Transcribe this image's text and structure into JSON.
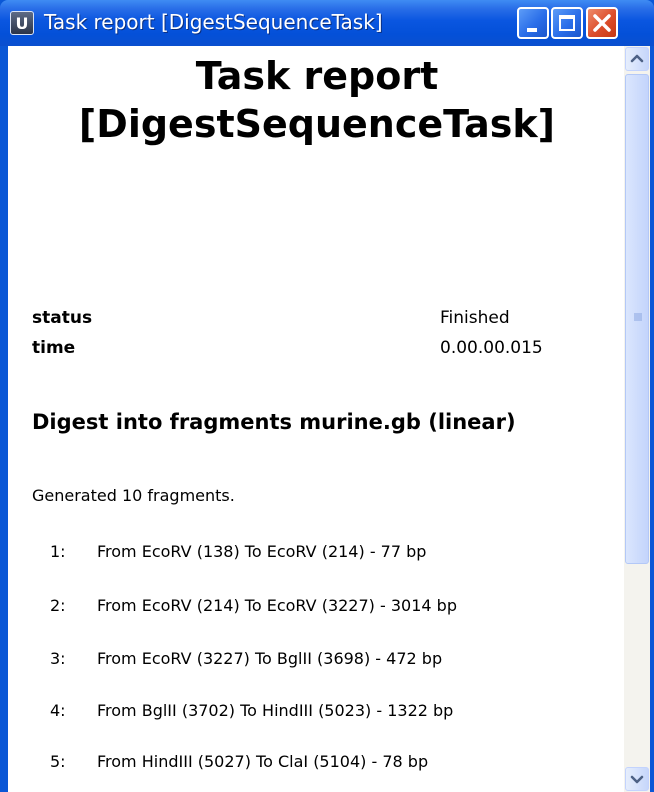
{
  "window": {
    "title": "Task report [DigestSequenceTask]",
    "app_icon_letter": "U",
    "controls": {
      "minimize": "minimize-icon",
      "maximize": "maximize-icon",
      "close": "close-icon"
    }
  },
  "report": {
    "title_line1": "Task report",
    "title_line2": "[DigestSequenceTask]",
    "status_key": "status",
    "status_value": "Finished",
    "time_key": "time",
    "time_value": "0.00.00.015",
    "section_heading": "Digest into fragments murine.gb (linear)",
    "summary": "Generated 10 fragments.",
    "fragments": [
      {
        "num": "1:",
        "text": "From EcoRV (138) To EcoRV (214) - 77 bp"
      },
      {
        "num": "2:",
        "text": "From EcoRV (214) To EcoRV (3227) - 3014 bp"
      },
      {
        "num": "3:",
        "text": "From EcoRV (3227) To BglII (3698) - 472 bp"
      },
      {
        "num": "4:",
        "text": "From BglII (3702) To HindIII (5023) - 1322 bp"
      },
      {
        "num": "5:",
        "text": "From HindIII (5027) To ClaI (5104) - 78 bp"
      }
    ]
  },
  "colors": {
    "titlebar": "#0450d8",
    "close_button": "#dc4d2b",
    "content_background": "#ffffff",
    "scrollbar_track": "#f4f3ee"
  }
}
